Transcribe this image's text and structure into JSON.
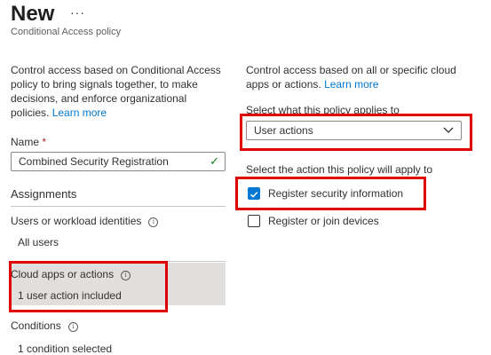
{
  "header": {
    "title": "New",
    "more_label": "···",
    "subtitle": "Conditional Access policy"
  },
  "left": {
    "intro": "Control access based on Conditional Access policy to bring signals together, to make decisions, and enforce organizational policies.",
    "learn_more": "Learn more",
    "name_label": "Name",
    "required_mark": "*",
    "name_value": "Combined Security Registration",
    "assignments_heading": "Assignments",
    "users": {
      "label": "Users or workload identities",
      "value": "All users"
    },
    "cloud_apps": {
      "label": "Cloud apps or actions",
      "value": "1 user action included"
    },
    "conditions": {
      "label": "Conditions",
      "value": "1 condition selected"
    }
  },
  "right": {
    "intro": "Control access based on all or specific cloud apps or actions.",
    "learn_more": "Learn more",
    "applies_label": "Select what this policy applies to",
    "applies_value": "User actions",
    "action_label": "Select the action this policy will apply to",
    "options": [
      {
        "label": "Register security information",
        "checked": true
      },
      {
        "label": "Register or join devices",
        "checked": false
      }
    ]
  },
  "colors": {
    "accent": "#0078d4",
    "highlight_box": "#e00000",
    "selected_row": "#e1dfdd",
    "valid_check": "#107c10"
  },
  "icons": [
    "ellipsis-icon",
    "info-icon",
    "checkmark-icon",
    "chevron-down-icon",
    "checkbox-checked-icon",
    "checkbox-unchecked-icon"
  ]
}
